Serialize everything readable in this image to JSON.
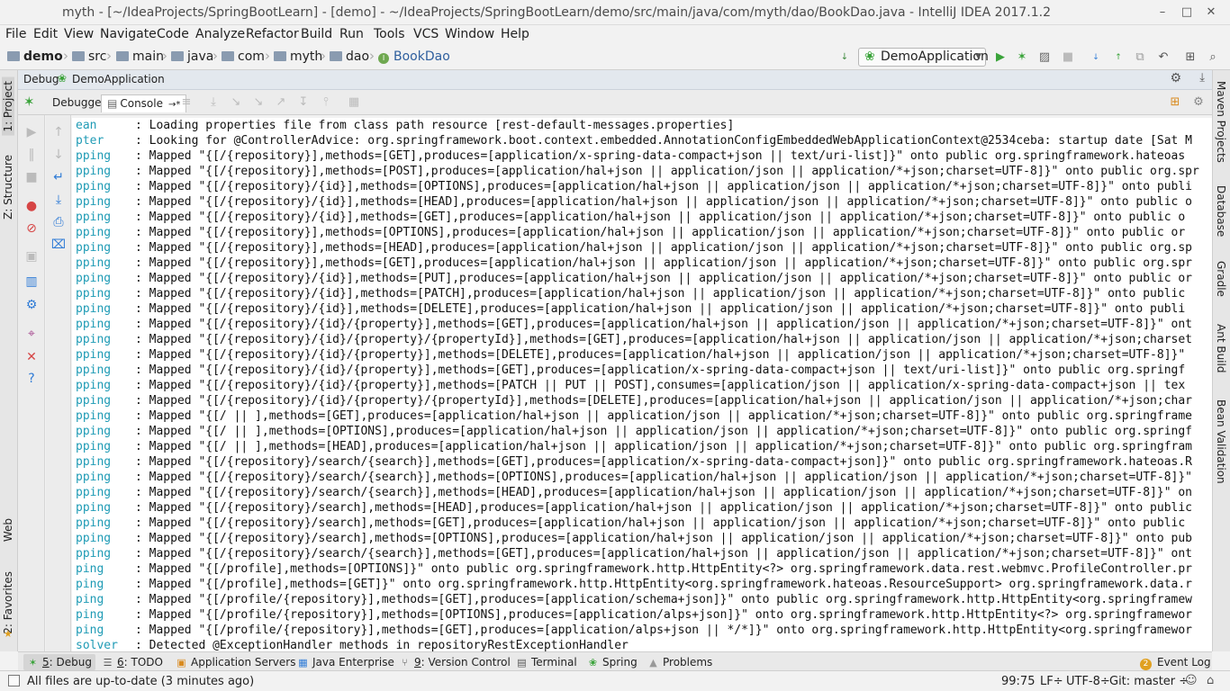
{
  "window": {
    "title": "myth - [~/IdeaProjects/SpringBootLearn] - [demo] - ~/IdeaProjects/SpringBootLearn/demo/src/main/java/com/myth/dao/BookDao.java - IntelliJ IDEA 2017.1.2",
    "minimize_icon": "minimize-icon",
    "maximize_icon": "maximize-icon",
    "close_icon": "close-icon"
  },
  "menu": [
    "File",
    "Edit",
    "View",
    "Navigate",
    "Code",
    "Analyze",
    "Refactor",
    "Build",
    "Run",
    "Tools",
    "VCS",
    "Window",
    "Help"
  ],
  "breadcrumb": [
    "demo",
    "src",
    "main",
    "java",
    "com",
    "myth",
    "dao",
    "BookDao"
  ],
  "run_config": {
    "label": "DemoApplication"
  },
  "left_tool_windows": [
    "1: Project",
    "Z: Structure",
    "Web",
    "2: Favorites"
  ],
  "right_tool_windows": [
    "Maven Projects",
    "Database",
    "Gradle",
    "Ant Build",
    "Bean Validation"
  ],
  "debug_panel": {
    "label": "Debug",
    "session": "DemoApplication",
    "tabs": [
      "Debugger",
      "Console"
    ],
    "active_tab": "Console",
    "tab_suffix": "→*"
  },
  "console": {
    "lines": [
      {
        "logger": "ean",
        "text": ": Loading properties file from class path resource [rest-default-messages.properties]"
      },
      {
        "logger": "pter",
        "text": ": Looking for @ControllerAdvice: org.springframework.boot.context.embedded.AnnotationConfigEmbeddedWebApplicationContext@2534ceba: startup date [Sat M"
      },
      {
        "logger": "pping",
        "text": ": Mapped \"{[/{repository}],methods=[GET],produces=[application/x-spring-data-compact+json || text/uri-list]}\" onto public org.springframework.hateoas"
      },
      {
        "logger": "pping",
        "text": ": Mapped \"{[/{repository}],methods=[POST],produces=[application/hal+json || application/json || application/*+json;charset=UTF-8]}\" onto public org.spr"
      },
      {
        "logger": "pping",
        "text": ": Mapped \"{[/{repository}/{id}],methods=[OPTIONS],produces=[application/hal+json || application/json || application/*+json;charset=UTF-8]}\" onto publi"
      },
      {
        "logger": "pping",
        "text": ": Mapped \"{[/{repository}/{id}],methods=[HEAD],produces=[application/hal+json || application/json || application/*+json;charset=UTF-8]}\" onto public o"
      },
      {
        "logger": "pping",
        "text": ": Mapped \"{[/{repository}/{id}],methods=[GET],produces=[application/hal+json || application/json || application/*+json;charset=UTF-8]}\" onto public o"
      },
      {
        "logger": "pping",
        "text": ": Mapped \"{[/{repository}],methods=[OPTIONS],produces=[application/hal+json || application/json || application/*+json;charset=UTF-8]}\" onto public or"
      },
      {
        "logger": "pping",
        "text": ": Mapped \"{[/{repository}],methods=[HEAD],produces=[application/hal+json || application/json || application/*+json;charset=UTF-8]}\" onto public org.sp"
      },
      {
        "logger": "pping",
        "text": ": Mapped \"{[/{repository}],methods=[GET],produces=[application/hal+json || application/json || application/*+json;charset=UTF-8]}\" onto public org.spr"
      },
      {
        "logger": "pping",
        "text": ": Mapped \"{[/{repository}/{id}],methods=[PUT],produces=[application/hal+json || application/json || application/*+json;charset=UTF-8]}\" onto public or"
      },
      {
        "logger": "pping",
        "text": ": Mapped \"{[/{repository}/{id}],methods=[PATCH],produces=[application/hal+json || application/json || application/*+json;charset=UTF-8]}\" onto public"
      },
      {
        "logger": "pping",
        "text": ": Mapped \"{[/{repository}/{id}],methods=[DELETE],produces=[application/hal+json || application/json || application/*+json;charset=UTF-8]}\" onto publi"
      },
      {
        "logger": "pping",
        "text": ": Mapped \"{[/{repository}/{id}/{property}],methods=[GET],produces=[application/hal+json || application/json || application/*+json;charset=UTF-8]}\" ont"
      },
      {
        "logger": "pping",
        "text": ": Mapped \"{[/{repository}/{id}/{property}/{propertyId}],methods=[GET],produces=[application/hal+json || application/json || application/*+json;charset"
      },
      {
        "logger": "pping",
        "text": ": Mapped \"{[/{repository}/{id}/{property}],methods=[DELETE],produces=[application/hal+json || application/json || application/*+json;charset=UTF-8]}\""
      },
      {
        "logger": "pping",
        "text": ": Mapped \"{[/{repository}/{id}/{property}],methods=[GET],produces=[application/x-spring-data-compact+json || text/uri-list]}\" onto public org.springf"
      },
      {
        "logger": "pping",
        "text": ": Mapped \"{[/{repository}/{id}/{property}],methods=[PATCH || PUT || POST],consumes=[application/json || application/x-spring-data-compact+json || tex"
      },
      {
        "logger": "pping",
        "text": ": Mapped \"{[/{repository}/{id}/{property}/{propertyId}],methods=[DELETE],produces=[application/hal+json || application/json || application/*+json;char"
      },
      {
        "logger": "pping",
        "text": ": Mapped \"{[/ || ],methods=[GET],produces=[application/hal+json || application/json || application/*+json;charset=UTF-8]}\" onto public org.springframe"
      },
      {
        "logger": "pping",
        "text": ": Mapped \"{[/ || ],methods=[OPTIONS],produces=[application/hal+json || application/json || application/*+json;charset=UTF-8]}\" onto public org.springf"
      },
      {
        "logger": "pping",
        "text": ": Mapped \"{[/ || ],methods=[HEAD],produces=[application/hal+json || application/json || application/*+json;charset=UTF-8]}\" onto public org.springfram"
      },
      {
        "logger": "pping",
        "text": ": Mapped \"{[/{repository}/search/{search}],methods=[GET],produces=[application/x-spring-data-compact+json]}\" onto public org.springframework.hateoas.R"
      },
      {
        "logger": "pping",
        "text": ": Mapped \"{[/{repository}/search/{search}],methods=[OPTIONS],produces=[application/hal+json || application/json || application/*+json;charset=UTF-8]}\""
      },
      {
        "logger": "pping",
        "text": ": Mapped \"{[/{repository}/search/{search}],methods=[HEAD],produces=[application/hal+json || application/json || application/*+json;charset=UTF-8]}\" on"
      },
      {
        "logger": "pping",
        "text": ": Mapped \"{[/{repository}/search],methods=[HEAD],produces=[application/hal+json || application/json || application/*+json;charset=UTF-8]}\" onto public"
      },
      {
        "logger": "pping",
        "text": ": Mapped \"{[/{repository}/search],methods=[GET],produces=[application/hal+json || application/json || application/*+json;charset=UTF-8]}\" onto public"
      },
      {
        "logger": "pping",
        "text": ": Mapped \"{[/{repository}/search],methods=[OPTIONS],produces=[application/hal+json || application/json || application/*+json;charset=UTF-8]}\" onto pub"
      },
      {
        "logger": "pping",
        "text": ": Mapped \"{[/{repository}/search/{search}],methods=[GET],produces=[application/hal+json || application/json || application/*+json;charset=UTF-8]}\" ont"
      },
      {
        "logger": "ping",
        "text": ": Mapped \"{[/profile],methods=[OPTIONS]}\" onto public org.springframework.http.HttpEntity<?> org.springframework.data.rest.webmvc.ProfileController.pr"
      },
      {
        "logger": "ping",
        "text": ": Mapped \"{[/profile],methods=[GET]}\" onto org.springframework.http.HttpEntity<org.springframework.hateoas.ResourceSupport> org.springframework.data.r"
      },
      {
        "logger": "ping",
        "text": ": Mapped \"{[/profile/{repository}],methods=[GET],produces=[application/schema+json]}\" onto public org.springframework.http.HttpEntity<org.springframew"
      },
      {
        "logger": "ping",
        "text": ": Mapped \"{[/profile/{repository}],methods=[OPTIONS],produces=[application/alps+json]}\" onto org.springframework.http.HttpEntity<?> org.springframewor"
      },
      {
        "logger": "ping",
        "text": ": Mapped \"{[/profile/{repository}],methods=[GET],produces=[application/alps+json || */*]}\" onto org.springframework.http.HttpEntity<org.springframewor"
      },
      {
        "logger": "solver",
        "text": ": Detected @ExceptionHandler methods in repositoryRestExceptionHandler"
      }
    ]
  },
  "bottom_tabs": [
    {
      "num": "5",
      "label": ": Debug",
      "icon": "bug-icon"
    },
    {
      "num": "6",
      "label": ": TODO",
      "icon": "todo-icon"
    },
    {
      "num": "",
      "label": "Application Servers",
      "icon": "server-icon"
    },
    {
      "num": "",
      "label": "Java Enterprise",
      "icon": "java-enterprise-icon"
    },
    {
      "num": "9",
      "label": ": Version Control",
      "icon": "vcs-icon"
    },
    {
      "num": "",
      "label": "Terminal",
      "icon": "terminal-icon"
    },
    {
      "num": "",
      "label": "Spring",
      "icon": "spring-icon"
    },
    {
      "num": "",
      "label": "Problems",
      "icon": "problems-icon"
    }
  ],
  "event_log": {
    "count": "2",
    "label": "Event Log"
  },
  "status": {
    "message": "All files are up-to-date (3 minutes ago)",
    "position": "99:75",
    "line_separator": "LF÷",
    "encoding": "UTF-8÷",
    "git": "Git: master ÷"
  },
  "colors": {
    "logger": "#1f9bb5",
    "accent": "#2f7bd6",
    "run_green": "#3aa33a",
    "stop_red": "#d64545"
  }
}
